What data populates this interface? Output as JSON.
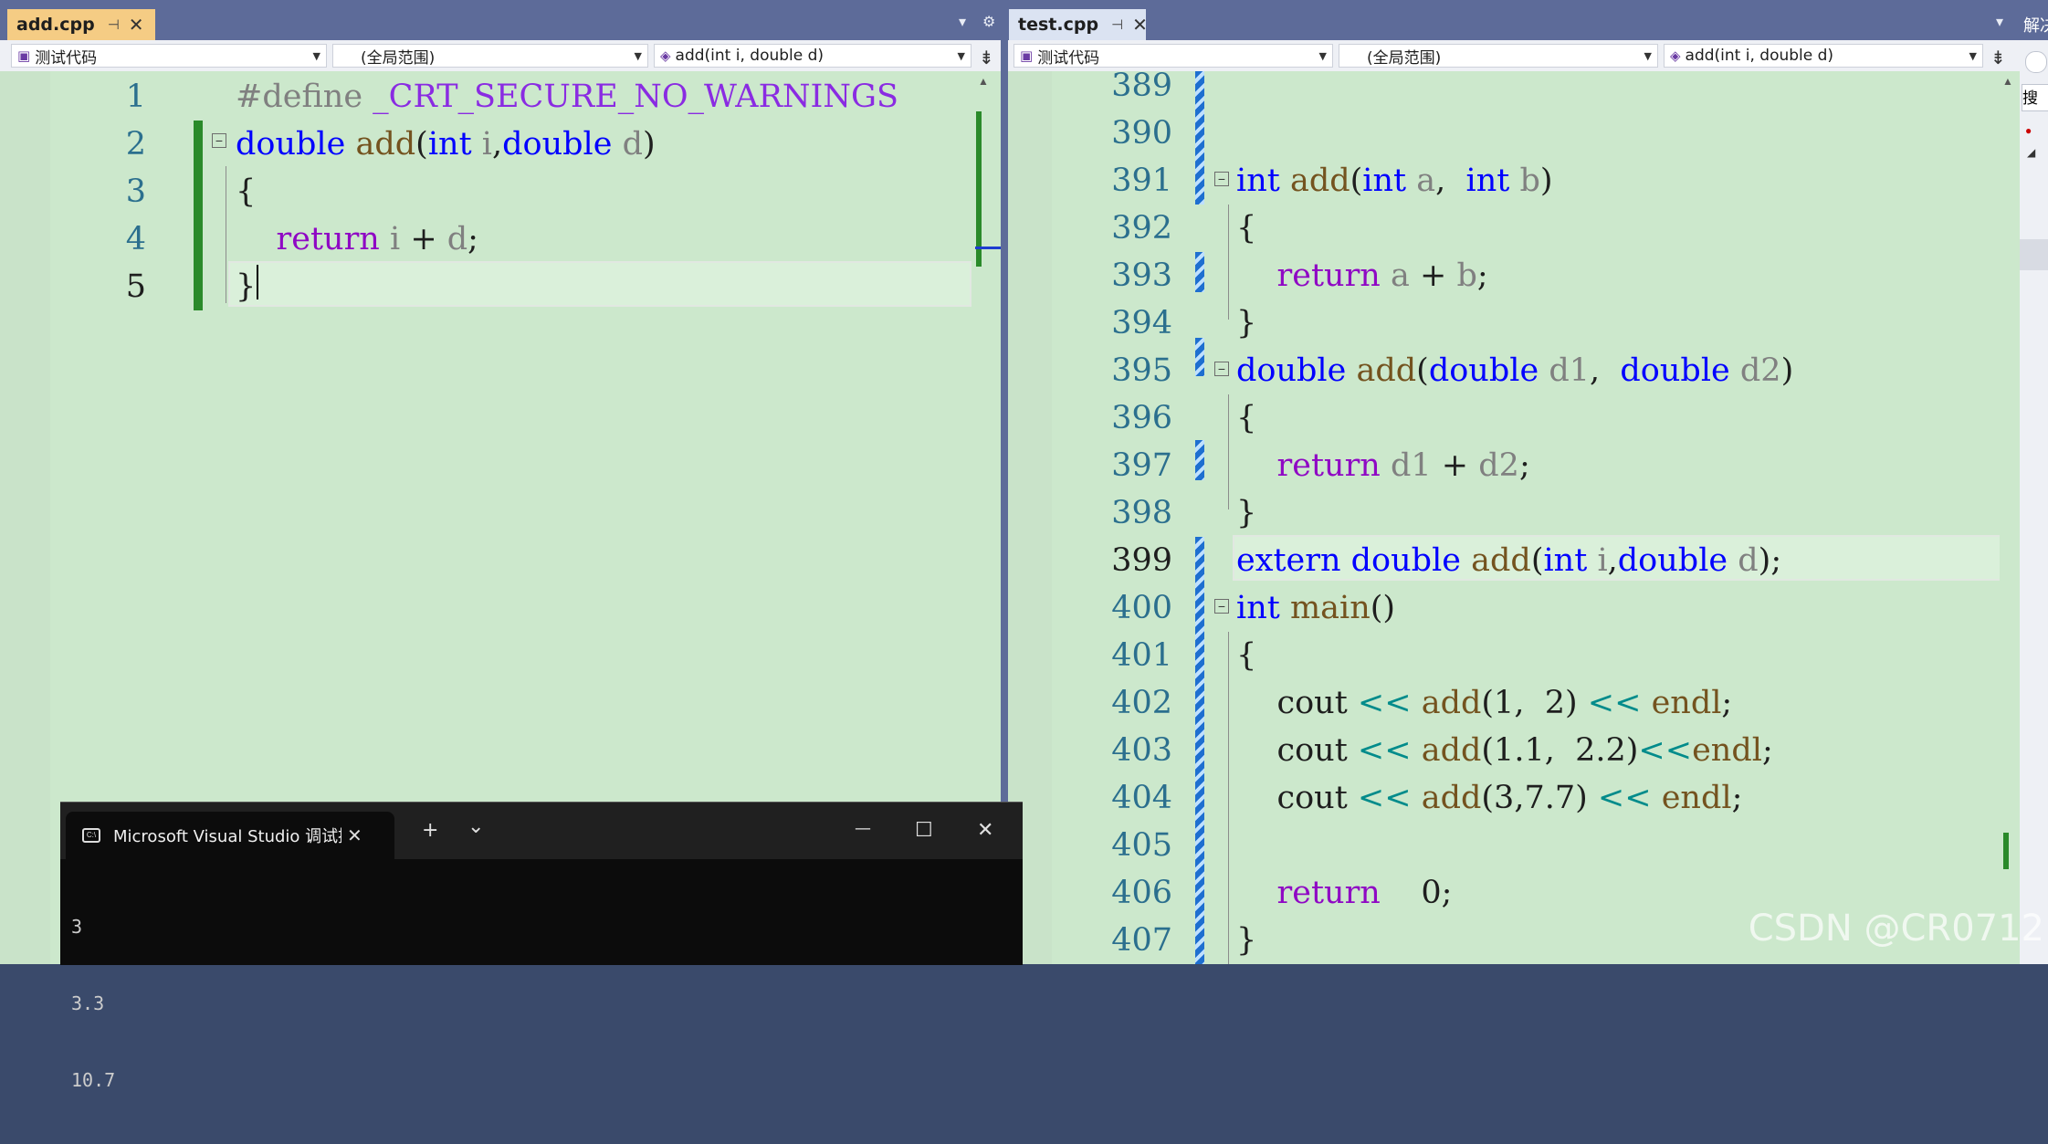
{
  "left_editor": {
    "tab": {
      "filename": "add.cpp",
      "pin": "⊣",
      "close": "✕"
    },
    "nav": {
      "project": "测试代码",
      "scope": "(全局范围)",
      "member": "add(int i, double d)"
    },
    "lines": [
      {
        "no": "1",
        "parts": [
          {
            "t": "#define ",
            "c": "pp"
          },
          {
            "t": "_CRT_SECURE_NO_WARNINGS",
            "c": "mac"
          }
        ]
      },
      {
        "no": "2",
        "parts": [
          {
            "t": "double",
            "c": "kw"
          },
          {
            "t": " "
          },
          {
            "t": "add",
            "c": "fn"
          },
          {
            "t": "("
          },
          {
            "t": "int",
            "c": "kw"
          },
          {
            "t": " "
          },
          {
            "t": "i",
            "c": "par"
          },
          {
            "t": ","
          },
          {
            "t": "double",
            "c": "kw"
          },
          {
            "t": " "
          },
          {
            "t": "d",
            "c": "par"
          },
          {
            "t": ")"
          }
        ]
      },
      {
        "no": "3",
        "parts": [
          {
            "t": "{"
          }
        ]
      },
      {
        "no": "4",
        "parts": [
          {
            "t": "    "
          },
          {
            "t": "return",
            "c": "ret"
          },
          {
            "t": " "
          },
          {
            "t": "i",
            "c": "par"
          },
          {
            "t": " + "
          },
          {
            "t": "d",
            "c": "par"
          },
          {
            "t": ";"
          }
        ]
      },
      {
        "no": "5",
        "parts": [
          {
            "t": "}"
          }
        ]
      }
    ]
  },
  "right_editor": {
    "tab": {
      "filename": "test.cpp",
      "pin": "⊣",
      "close": "✕"
    },
    "nav": {
      "project": "测试代码",
      "scope": "(全局范围)",
      "member": "add(int i, double d)"
    },
    "lines": [
      {
        "no": "389",
        "parts": []
      },
      {
        "no": "390",
        "parts": []
      },
      {
        "no": "391",
        "parts": [
          {
            "t": "int",
            "c": "kw"
          },
          {
            "t": " "
          },
          {
            "t": "add",
            "c": "fn"
          },
          {
            "t": "("
          },
          {
            "t": "int",
            "c": "kw"
          },
          {
            "t": " "
          },
          {
            "t": "a",
            "c": "par"
          },
          {
            "t": ",  "
          },
          {
            "t": "int",
            "c": "kw"
          },
          {
            "t": " "
          },
          {
            "t": "b",
            "c": "par"
          },
          {
            "t": ")"
          }
        ]
      },
      {
        "no": "392",
        "parts": [
          {
            "t": "{"
          }
        ]
      },
      {
        "no": "393",
        "parts": [
          {
            "t": "    "
          },
          {
            "t": "return",
            "c": "ret"
          },
          {
            "t": " "
          },
          {
            "t": "a",
            "c": "par"
          },
          {
            "t": " + "
          },
          {
            "t": "b",
            "c": "par"
          },
          {
            "t": ";"
          }
        ]
      },
      {
        "no": "394",
        "parts": [
          {
            "t": "}"
          }
        ]
      },
      {
        "no": "395",
        "parts": [
          {
            "t": "double",
            "c": "kw"
          },
          {
            "t": " "
          },
          {
            "t": "add",
            "c": "fn"
          },
          {
            "t": "("
          },
          {
            "t": "double",
            "c": "kw"
          },
          {
            "t": " "
          },
          {
            "t": "d1",
            "c": "par"
          },
          {
            "t": ",  "
          },
          {
            "t": "double",
            "c": "kw"
          },
          {
            "t": " "
          },
          {
            "t": "d2",
            "c": "par"
          },
          {
            "t": ")"
          }
        ]
      },
      {
        "no": "396",
        "parts": [
          {
            "t": "{"
          }
        ]
      },
      {
        "no": "397",
        "parts": [
          {
            "t": "    "
          },
          {
            "t": "return",
            "c": "ret"
          },
          {
            "t": " "
          },
          {
            "t": "d1",
            "c": "par"
          },
          {
            "t": " + "
          },
          {
            "t": "d2",
            "c": "par"
          },
          {
            "t": ";"
          }
        ]
      },
      {
        "no": "398",
        "parts": [
          {
            "t": "}"
          }
        ]
      },
      {
        "no": "399",
        "parts": [
          {
            "t": "extern",
            "c": "kw"
          },
          {
            "t": " "
          },
          {
            "t": "double",
            "c": "kw"
          },
          {
            "t": " "
          },
          {
            "t": "add",
            "c": "fn"
          },
          {
            "t": "("
          },
          {
            "t": "int",
            "c": "kw"
          },
          {
            "t": " "
          },
          {
            "t": "i",
            "c": "par"
          },
          {
            "t": ","
          },
          {
            "t": "double",
            "c": "kw"
          },
          {
            "t": " "
          },
          {
            "t": "d",
            "c": "par"
          },
          {
            "t": ");"
          }
        ]
      },
      {
        "no": "400",
        "parts": [
          {
            "t": "int",
            "c": "kw"
          },
          {
            "t": " "
          },
          {
            "t": "main",
            "c": "fn"
          },
          {
            "t": "()"
          }
        ]
      },
      {
        "no": "401",
        "parts": [
          {
            "t": "{"
          }
        ]
      },
      {
        "no": "402",
        "parts": [
          {
            "t": "    cout "
          },
          {
            "t": "<<",
            "c": "str"
          },
          {
            "t": " "
          },
          {
            "t": "add",
            "c": "fn"
          },
          {
            "t": "(1,  2) "
          },
          {
            "t": "<<",
            "c": "str"
          },
          {
            "t": " "
          },
          {
            "t": "endl",
            "c": "fn"
          },
          {
            "t": ";"
          }
        ]
      },
      {
        "no": "403",
        "parts": [
          {
            "t": "    cout "
          },
          {
            "t": "<<",
            "c": "str"
          },
          {
            "t": " "
          },
          {
            "t": "add",
            "c": "fn"
          },
          {
            "t": "(1.1,  2.2)"
          },
          {
            "t": "<<",
            "c": "str"
          },
          {
            "t": "endl",
            "c": "fn"
          },
          {
            "t": ";"
          }
        ]
      },
      {
        "no": "404",
        "parts": [
          {
            "t": "    cout "
          },
          {
            "t": "<<",
            "c": "str"
          },
          {
            "t": " "
          },
          {
            "t": "add",
            "c": "fn"
          },
          {
            "t": "(3,7.7) "
          },
          {
            "t": "<<",
            "c": "str"
          },
          {
            "t": " "
          },
          {
            "t": "endl",
            "c": "fn"
          },
          {
            "t": ";"
          }
        ]
      },
      {
        "no": "405",
        "parts": []
      },
      {
        "no": "406",
        "parts": [
          {
            "t": "    "
          },
          {
            "t": "return",
            "c": "ret"
          },
          {
            "t": "    0;"
          }
        ]
      },
      {
        "no": "407",
        "parts": [
          {
            "t": "}"
          }
        ]
      }
    ]
  },
  "side_panel": {
    "title": "解决",
    "search": "搜"
  },
  "terminal": {
    "title": "Microsoft Visual Studio 调试控制台",
    "close": "✕",
    "new_tab": "+",
    "dropdown": "⌄",
    "minimize": "—",
    "maximize": "☐",
    "win_close": "✕",
    "output": [
      "3",
      "3.3",
      "10.7"
    ]
  },
  "watermark": "CSDN @CR0712",
  "colors": {
    "editor_bg": "#cce8cc",
    "tab_active": "#f5cc84",
    "chrome": "#5d6b99",
    "keyword": "#0000ff",
    "function": "#74531f",
    "return_kw": "#8f08c4",
    "param": "#808080",
    "macro": "#8a2be2"
  }
}
